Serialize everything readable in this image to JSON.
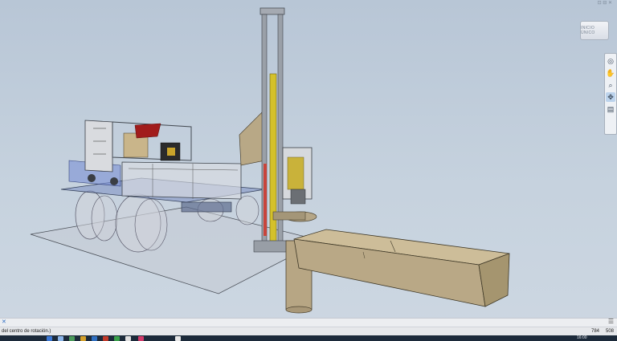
{
  "window": {
    "corner_mark": "⊡ ⊟ ✕"
  },
  "viewcube": {
    "label": "INICIO ÚNICO"
  },
  "navbar": {
    "items": [
      "steering-wheel-icon",
      "pan-hand-icon",
      "zoom-icon",
      "orbit-icon",
      "look-at-icon"
    ]
  },
  "status": {
    "prompt_text": "del centro de rotación.)",
    "value_a": "784",
    "value_b": "508"
  },
  "taskbar": {
    "clock": "16:00"
  },
  "colors": {
    "background_top": "#b8c6d6",
    "mast_yellow": "#d4c12a",
    "trough_tan": "#b9a886",
    "mast_grey": "#8d949c"
  }
}
